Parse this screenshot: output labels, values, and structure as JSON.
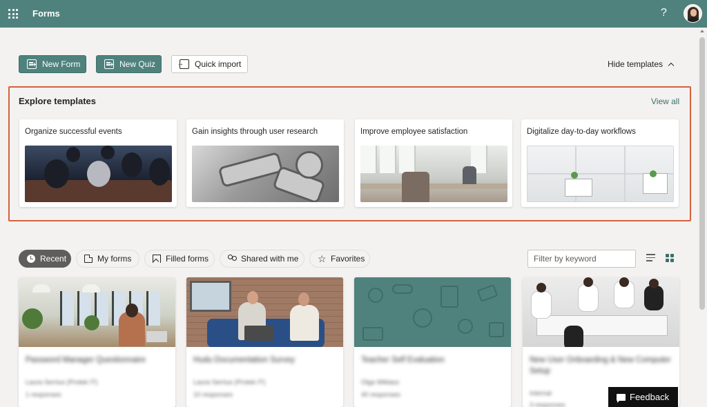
{
  "header": {
    "app_name": "Forms",
    "help_label": "?",
    "bar_color": "#4f827d"
  },
  "actions": {
    "new_form": "New Form",
    "new_quiz": "New Quiz",
    "quick_import": "Quick import",
    "hide_templates": "Hide templates"
  },
  "templates": {
    "title": "Explore templates",
    "view_all": "View all",
    "cards": [
      {
        "label": "Organize successful events"
      },
      {
        "label": "Gain insights through user research"
      },
      {
        "label": "Improve employee satisfaction"
      },
      {
        "label": "Digitalize day-to-day workflows"
      }
    ]
  },
  "filters": {
    "tabs": [
      {
        "label": "Recent",
        "active": true
      },
      {
        "label": "My forms",
        "active": false
      },
      {
        "label": "Filled forms",
        "active": false
      },
      {
        "label": "Shared with me",
        "active": false
      },
      {
        "label": "Favorites",
        "active": false
      }
    ],
    "search_placeholder": "Filter by keyword",
    "view_mode": "grid"
  },
  "forms": [
    {
      "title": "Password Manager Questionnaire",
      "owner": "Laura Serrius (Protek IT)",
      "responses": "1 responses"
    },
    {
      "title": "Hudu Documentation Survey",
      "owner": "Laura Serrius (Protek IT)",
      "responses": "10 responses"
    },
    {
      "title": "Teacher Self Evaluation",
      "owner": "Olga Wiklasz",
      "responses": "40 responses"
    },
    {
      "title": "New User Onboarding & New Computer Setup",
      "owner": "Internal",
      "responses": "3 responses"
    }
  ],
  "feedback": {
    "label": "Feedback"
  },
  "colors": {
    "accent": "#4f827d",
    "highlight_border": "#d5603a",
    "link": "#3b6f6a"
  }
}
